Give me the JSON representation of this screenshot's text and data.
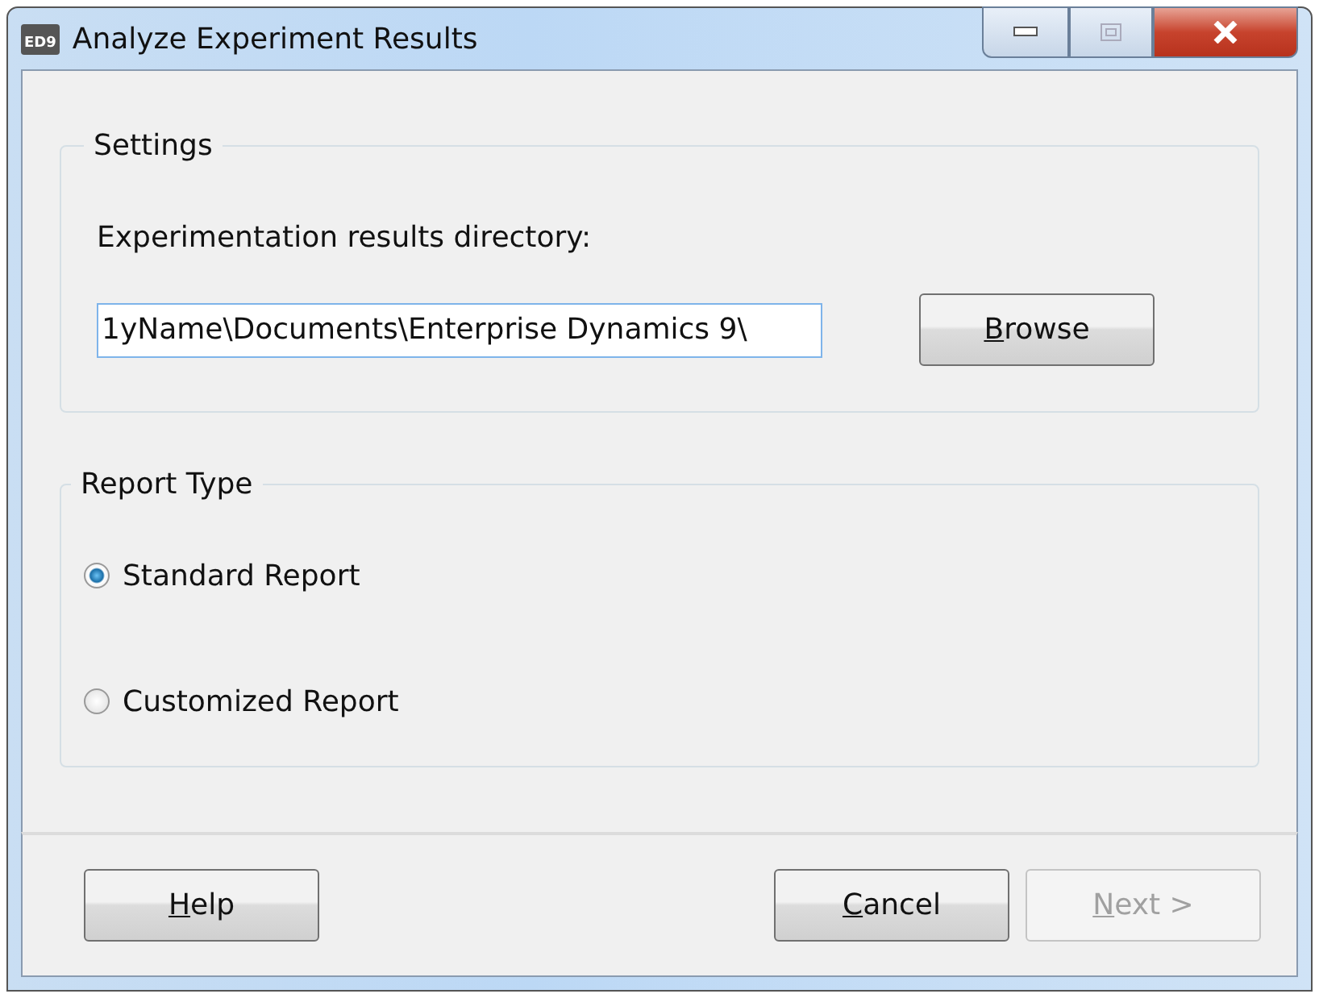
{
  "window": {
    "title": "Analyze Experiment Results",
    "app_icon_text": "ED9"
  },
  "settings": {
    "title": "Settings",
    "directory_label": "Experimentation results directory:",
    "directory_value": "1yName\\Documents\\Enterprise Dynamics 9\\",
    "browse_button": "Browse"
  },
  "report_type": {
    "title": "Report Type",
    "options": [
      {
        "label": "Standard Report",
        "selected": true
      },
      {
        "label": "Customized Report",
        "selected": false
      }
    ]
  },
  "left_buttons": [
    {
      "label": "Help",
      "disabled": false
    }
  ],
  "right_buttons": [
    {
      "label": "Cancel",
      "disabled": false
    },
    {
      "label": "Next >",
      "disabled": true
    }
  ]
}
